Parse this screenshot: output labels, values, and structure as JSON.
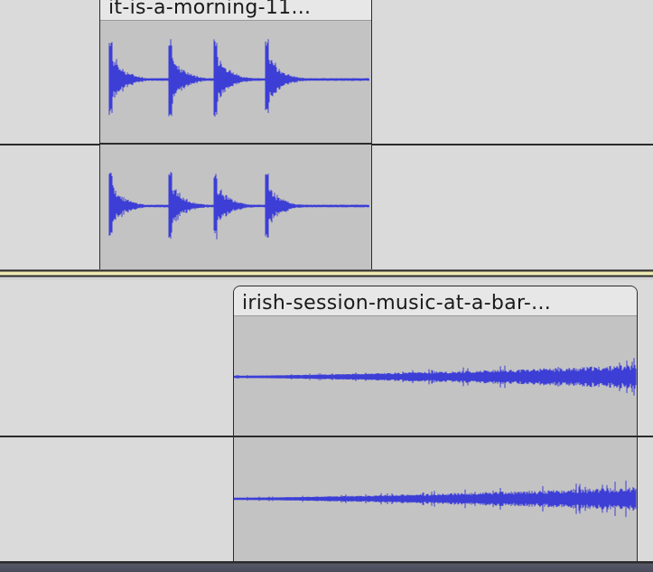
{
  "tracks": [
    {
      "clips": [
        {
          "title": "it-is-a-morning-11..."
        }
      ]
    },
    {
      "clips": [
        {
          "title": "irish-session-music-at-a-bar-..."
        }
      ]
    }
  ],
  "colors": {
    "waveform": "#3c3ed6",
    "clip_body": "#c3c3c3",
    "track_background": "#dadada",
    "selection_separator": "#f3eeba"
  }
}
